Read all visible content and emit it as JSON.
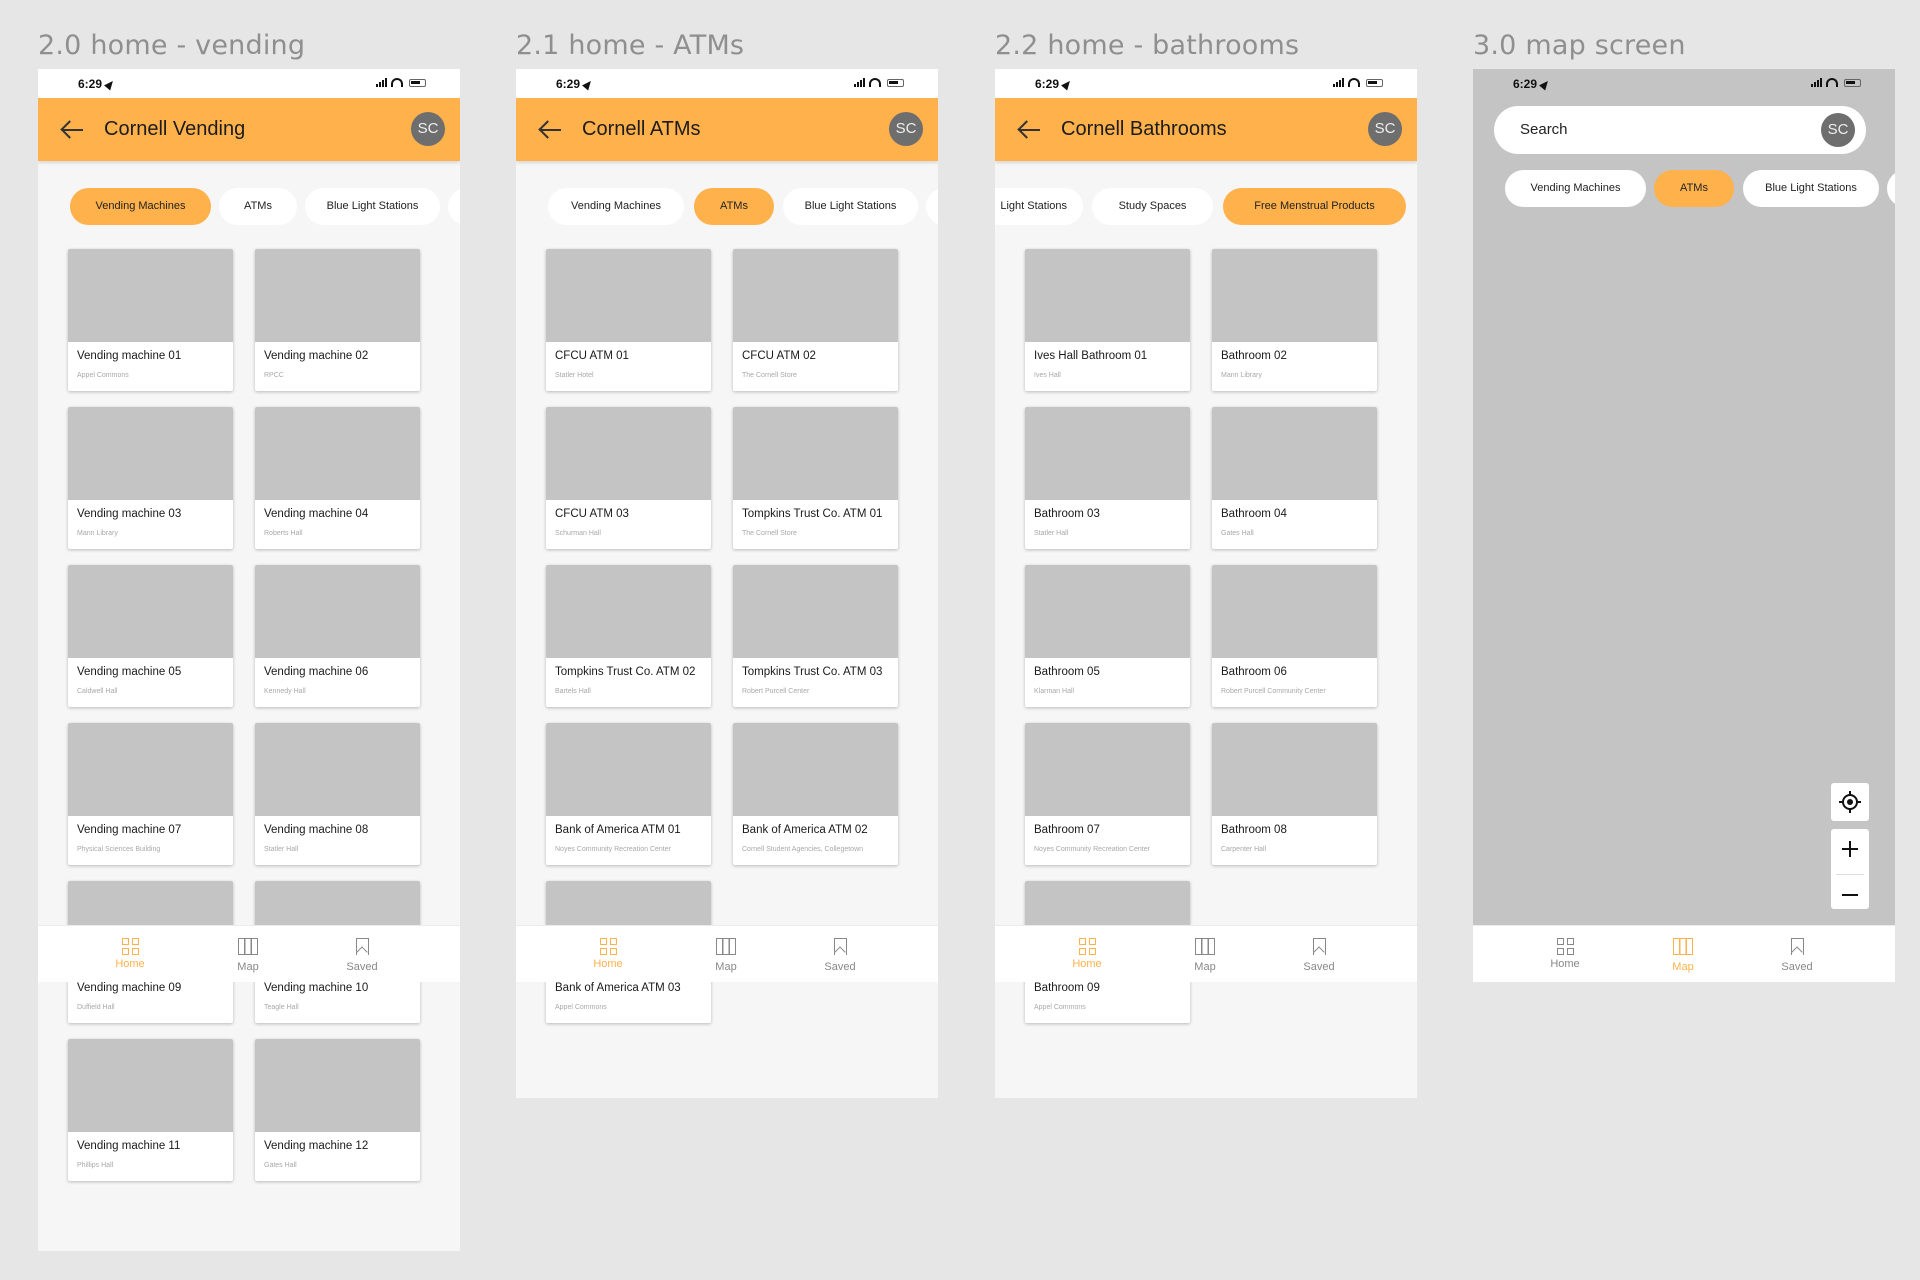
{
  "status_time": "6:29",
  "avatar_initials": "SC",
  "nav": {
    "home": "Home",
    "map": "Map",
    "saved": "Saved"
  },
  "chip_labels": {
    "vending": "Vending Machines",
    "atms": "ATMs",
    "blue_light": "Blue Light Stations",
    "blue_light_cut": "Light Stations",
    "study": "Study Spaces",
    "menstrual": "Free Menstrual Products"
  },
  "frames": {
    "vending": {
      "label": "2.0 home - vending",
      "header_title": "Cornell Vending",
      "cards": [
        {
          "title": "Vending machine 01",
          "location": "Appel Commons"
        },
        {
          "title": "Vending machine 02",
          "location": "RPCC"
        },
        {
          "title": "Vending machine 03",
          "location": "Mann Library"
        },
        {
          "title": "Vending machine 04",
          "location": "Roberts Hall"
        },
        {
          "title": "Vending machine 05",
          "location": "Caldwell Hall"
        },
        {
          "title": "Vending machine 06",
          "location": "Kennedy Hall"
        },
        {
          "title": "Vending machine 07",
          "location": "Physical Sciences Building"
        },
        {
          "title": "Vending machine 08",
          "location": "Statler Hall"
        },
        {
          "title": "Vending machine 09",
          "location": "Duffield Hall"
        },
        {
          "title": "Vending machine 10",
          "location": "Teagle Hall"
        },
        {
          "title": "Vending machine 11",
          "location": "Phillips Hall"
        },
        {
          "title": "Vending machine 12",
          "location": "Gates Hall"
        }
      ]
    },
    "atms": {
      "label": "2.1 home - ATMs",
      "header_title": "Cornell ATMs",
      "cards": [
        {
          "title": "CFCU ATM 01",
          "location": "Statler Hotel"
        },
        {
          "title": "CFCU ATM 02",
          "location": "The Cornell Store"
        },
        {
          "title": "CFCU ATM 03",
          "location": "Schurman Hall"
        },
        {
          "title": "Tompkins Trust Co. ATM 01",
          "location": "The Cornell Store"
        },
        {
          "title": "Tompkins Trust Co. ATM 02",
          "location": "Bartels Hall"
        },
        {
          "title": "Tompkins Trust Co. ATM 03",
          "location": "Robert Purcell Center"
        },
        {
          "title": "Bank of America ATM 01",
          "location": "Noyes Community Recreation Center"
        },
        {
          "title": "Bank of America ATM 02",
          "location": "Cornell Student Agencies, Collegetown"
        },
        {
          "title": "Bank of America ATM 03",
          "location": "Appel Commons"
        }
      ]
    },
    "bathrooms": {
      "label": "2.2 home - bathrooms",
      "header_title": "Cornell Bathrooms",
      "cards": [
        {
          "title": "Ives Hall Bathroom 01",
          "location": "Ives Hall"
        },
        {
          "title": "Bathroom 02",
          "location": "Mann Library"
        },
        {
          "title": "Bathroom 03",
          "location": "Statler Hall"
        },
        {
          "title": "Bathroom 04",
          "location": "Gates Hall"
        },
        {
          "title": "Bathroom 05",
          "location": "Klarman Hall"
        },
        {
          "title": "Bathroom 06",
          "location": "Robert Purcell Community Center"
        },
        {
          "title": "Bathroom 07",
          "location": "Noyes Community Recreation Center"
        },
        {
          "title": "Bathroom 08",
          "location": "Carpenter Hall"
        },
        {
          "title": "Bathroom 09",
          "location": "Appel Commons"
        }
      ]
    },
    "map": {
      "label": "3.0 map screen",
      "search_placeholder": "Search"
    }
  },
  "colors": {
    "accent": "#ffb14c",
    "placeholder": "#c4c4c4",
    "background": "#e6e6e6"
  },
  "icons": [
    "back-arrow-icon",
    "location-arrow-icon",
    "signal-icon",
    "wifi-icon",
    "battery-icon",
    "home-grid-icon",
    "map-icon",
    "bookmark-icon",
    "locate-me-icon",
    "plus-icon",
    "minus-icon"
  ]
}
